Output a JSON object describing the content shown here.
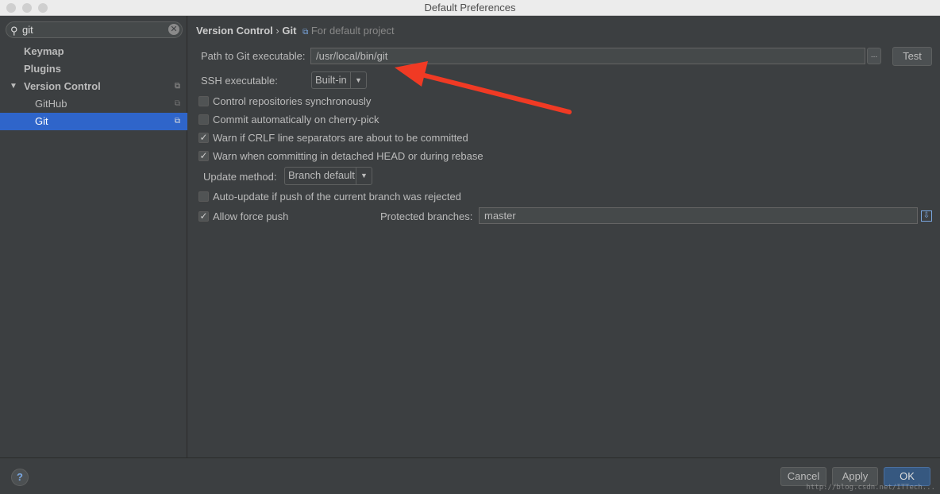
{
  "window": {
    "title": "Default Preferences"
  },
  "sidebar": {
    "search_value": "git",
    "items": [
      {
        "label": "Keymap"
      },
      {
        "label": "Plugins"
      },
      {
        "label": "Version Control"
      },
      {
        "label": "GitHub"
      },
      {
        "label": "Git"
      }
    ]
  },
  "breadcrumb": {
    "parent": "Version Control",
    "separator": "›",
    "current": "Git",
    "scope": "For default project"
  },
  "form": {
    "path_label": "Path to Git executable:",
    "path_value": "/usr/local/bin/git",
    "browse": "...",
    "test": "Test",
    "ssh_label": "SSH executable:",
    "ssh_value": "Built-in",
    "checkboxes": [
      {
        "label": "Control repositories synchronously",
        "checked": false
      },
      {
        "label": "Commit automatically on cherry-pick",
        "checked": false
      },
      {
        "label": "Warn if CRLF line separators are about to be committed",
        "checked": true
      },
      {
        "label": "Warn when committing in detached HEAD or during rebase",
        "checked": true
      },
      {
        "label": "Auto-update if push of the current branch was rejected",
        "checked": false
      },
      {
        "label": "Allow force push",
        "checked": true
      }
    ],
    "update_label": "Update method:",
    "update_value": "Branch default",
    "protected_label": "Protected branches:",
    "protected_value": "master"
  },
  "footer": {
    "help": "?",
    "cancel": "Cancel",
    "apply": "Apply",
    "ok": "OK",
    "watermark": "http://blog.csdn.net/ITTech..."
  },
  "colors": {
    "selection": "#2f65ca",
    "annotation_arrow": "#f03a24"
  }
}
